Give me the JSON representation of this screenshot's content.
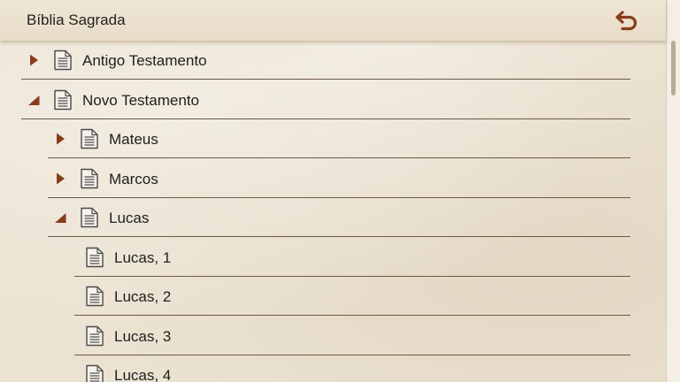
{
  "header": {
    "title": "Bíblia Sagrada",
    "back_icon": "undo-arrow-icon"
  },
  "colors": {
    "accent": "#8a3b1c",
    "divider": "#6b5a45",
    "background": "#ebe2d1"
  },
  "tree": {
    "items": [
      {
        "label": "Antigo Testamento",
        "level": 0,
        "expandable": true,
        "expanded": false
      },
      {
        "label": "Novo Testamento",
        "level": 0,
        "expandable": true,
        "expanded": true
      },
      {
        "label": "Mateus",
        "level": 1,
        "expandable": true,
        "expanded": false
      },
      {
        "label": "Marcos",
        "level": 1,
        "expandable": true,
        "expanded": false
      },
      {
        "label": "Lucas",
        "level": 1,
        "expandable": true,
        "expanded": true
      },
      {
        "label": "Lucas, 1",
        "level": 2,
        "expandable": false
      },
      {
        "label": "Lucas, 2",
        "level": 2,
        "expandable": false
      },
      {
        "label": "Lucas, 3",
        "level": 2,
        "expandable": false
      },
      {
        "label": "Lucas, 4",
        "level": 2,
        "expandable": false
      }
    ]
  }
}
